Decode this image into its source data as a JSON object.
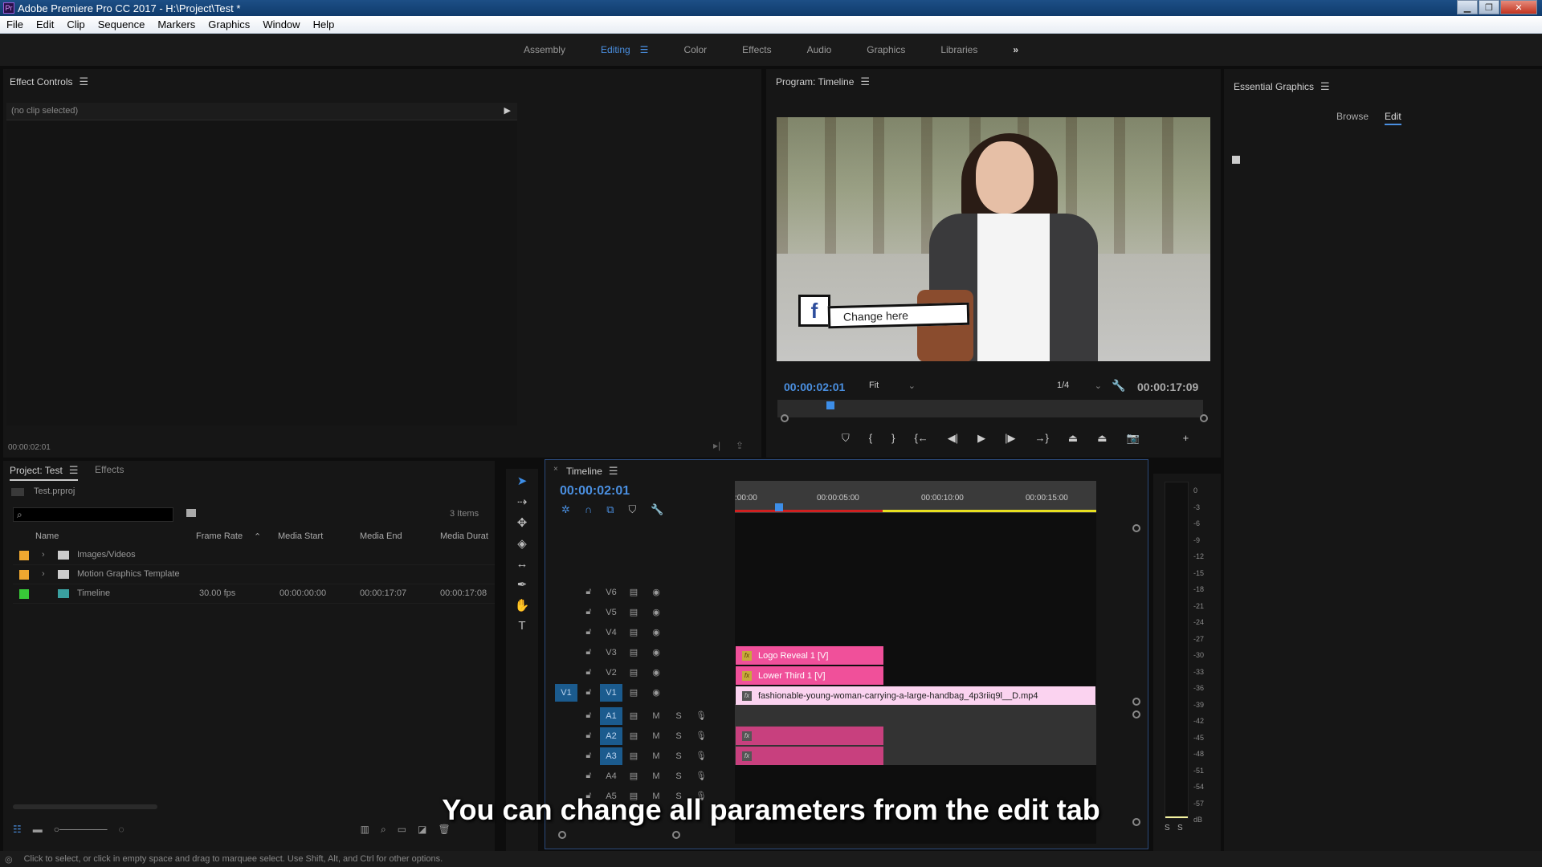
{
  "window": {
    "title": "Adobe Premiere Pro CC 2017 - H:\\Project\\Test *",
    "app_icon": "Pr"
  },
  "menu": [
    "File",
    "Edit",
    "Clip",
    "Sequence",
    "Markers",
    "Graphics",
    "Window",
    "Help"
  ],
  "workspaces": {
    "items": [
      "Assembly",
      "Editing",
      "Color",
      "Effects",
      "Audio",
      "Graphics",
      "Libraries"
    ],
    "active": "Editing",
    "more": "»"
  },
  "effect_controls": {
    "title": "Effect Controls",
    "no_clip": "(no clip selected)",
    "timecode": "00:00:02:01"
  },
  "program": {
    "title": "Program: Timeline",
    "overlay_text": "Change here",
    "overlay_icon": "f",
    "current_time": "00:00:02:01",
    "fit": "Fit",
    "resolution": "1/4",
    "duration": "00:00:17:09",
    "playhead_fraction": 0.117
  },
  "essential_graphics": {
    "title": "Essential Graphics",
    "tabs": [
      "Browse",
      "Edit"
    ],
    "active_tab": "Edit"
  },
  "project": {
    "tabs": [
      "Project: Test",
      "Effects"
    ],
    "file": "Test.prproj",
    "search_placeholder": "",
    "item_count": "3 Items",
    "columns": [
      "Name",
      "Frame Rate",
      "Media Start",
      "Media End",
      "Media Durat"
    ],
    "rows": [
      {
        "color": "#f0a830",
        "expand": true,
        "icon": "folder",
        "name": "Images/Videos",
        "frame_rate": "",
        "start": "",
        "end": "",
        "duration": ""
      },
      {
        "color": "#f0a830",
        "expand": true,
        "icon": "folder",
        "name": "Motion Graphics Template",
        "frame_rate": "",
        "start": "",
        "end": "",
        "duration": ""
      },
      {
        "color": "#38c838",
        "expand": false,
        "icon": "sequence",
        "name": "Timeline",
        "frame_rate": "30.00 fps",
        "start": "00:00:00:00",
        "end": "00:00:17:07",
        "duration": "00:00:17:08"
      }
    ]
  },
  "timeline": {
    "title": "Timeline",
    "current_time": "00:00:02:01",
    "ruler": [
      ":00:00",
      "00:00:05:00",
      "00:00:10:00",
      "00:00:15:00"
    ],
    "video_tracks": [
      "V6",
      "V5",
      "V4",
      "V3",
      "V2",
      "V1"
    ],
    "audio_tracks": [
      "A1",
      "A2",
      "A3",
      "A4",
      "A5"
    ],
    "source_patch": "V1",
    "clips": {
      "v3": "Logo Reveal 1 [V]",
      "v2": "Lower Third 1 [V]",
      "v1": "fashionable-young-woman-carrying-a-large-handbag_4p3riiq9l__D.mp4"
    },
    "mute_label": "M",
    "solo_label": "S"
  },
  "meter": {
    "ticks": [
      "0",
      "-3",
      "-6",
      "-9",
      "-12",
      "-15",
      "-18",
      "-21",
      "-24",
      "-27",
      "-30",
      "-33",
      "-36",
      "-39",
      "-42",
      "-45",
      "-48",
      "-51",
      "-54",
      "-57",
      "dB"
    ],
    "solo": [
      "S",
      "S"
    ]
  },
  "caption": "You can change all parameters from the edit tab",
  "status": "Click to select, or click in empty space and drag to marquee select. Use Shift, Alt, and Ctrl for other options.",
  "colors": {
    "accent": "#4a8fe0",
    "clip_pink": "#f0509a",
    "clip_light": "#fbd3f0",
    "audio_clip": "#c8407e"
  }
}
